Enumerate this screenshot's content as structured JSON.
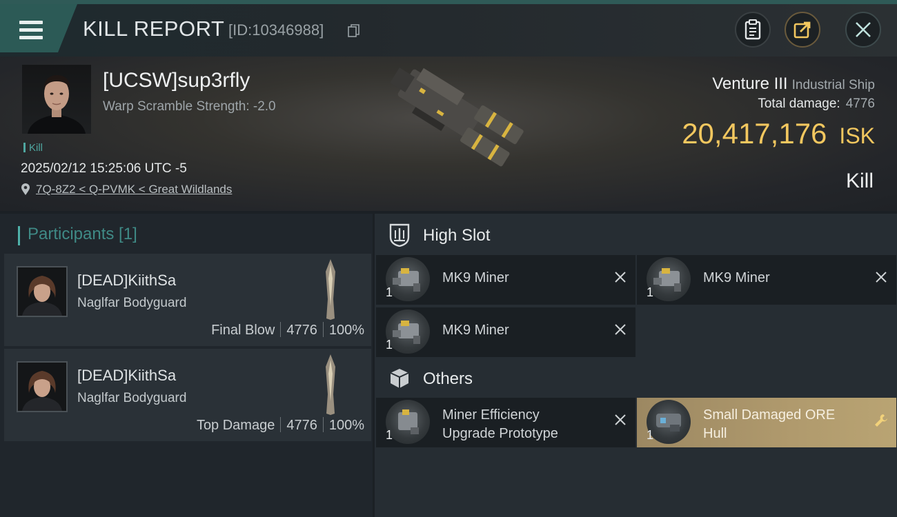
{
  "header": {
    "title": "KILL REPORT",
    "report_id": "[ID:10346988]"
  },
  "victim": {
    "name": "[UCSW]sup3rfly",
    "warp_scramble": "Warp Scramble Strength: -2.0",
    "tag": "Kill",
    "timestamp": "2025/02/12 15:25:06 UTC -5",
    "location": "7Q-8Z2 < Q-PVMK < Great Wildlands",
    "ship_name": "Venture III",
    "ship_class": "Industrial Ship",
    "total_damage_label": "Total damage:",
    "total_damage": "4776",
    "isk_value": "20,417,176",
    "isk_unit": "ISK",
    "result": "Kill"
  },
  "participants": {
    "label": "Participants [1]",
    "items": [
      {
        "name": "[DEAD]KiithSa",
        "corp": "Naglfar Bodyguard",
        "role": "Final Blow",
        "damage": "4776",
        "percent": "100%"
      },
      {
        "name": "[DEAD]KiithSa",
        "corp": "Naglfar Bodyguard",
        "role": "Top Damage",
        "damage": "4776",
        "percent": "100%"
      }
    ]
  },
  "fitting": {
    "high_slot": {
      "label": "High Slot",
      "items": [
        {
          "name": "MK9 Miner",
          "qty": "1"
        },
        {
          "name": "MK9 Miner",
          "qty": "1"
        },
        {
          "name": "MK9 Miner",
          "qty": "1"
        }
      ]
    },
    "others": {
      "label": "Others",
      "items": [
        {
          "name_line1": "Miner Efficiency",
          "name_line2": "Upgrade Prototype",
          "qty": "1"
        },
        {
          "name_line1": "Small Damaged ORE",
          "name_line2": "Hull",
          "qty": "1"
        }
      ]
    }
  },
  "colors": {
    "accent_teal": "#2c5a56",
    "isk_gold": "#f2c75f",
    "dropped_item_gold": "#b09a6d"
  }
}
